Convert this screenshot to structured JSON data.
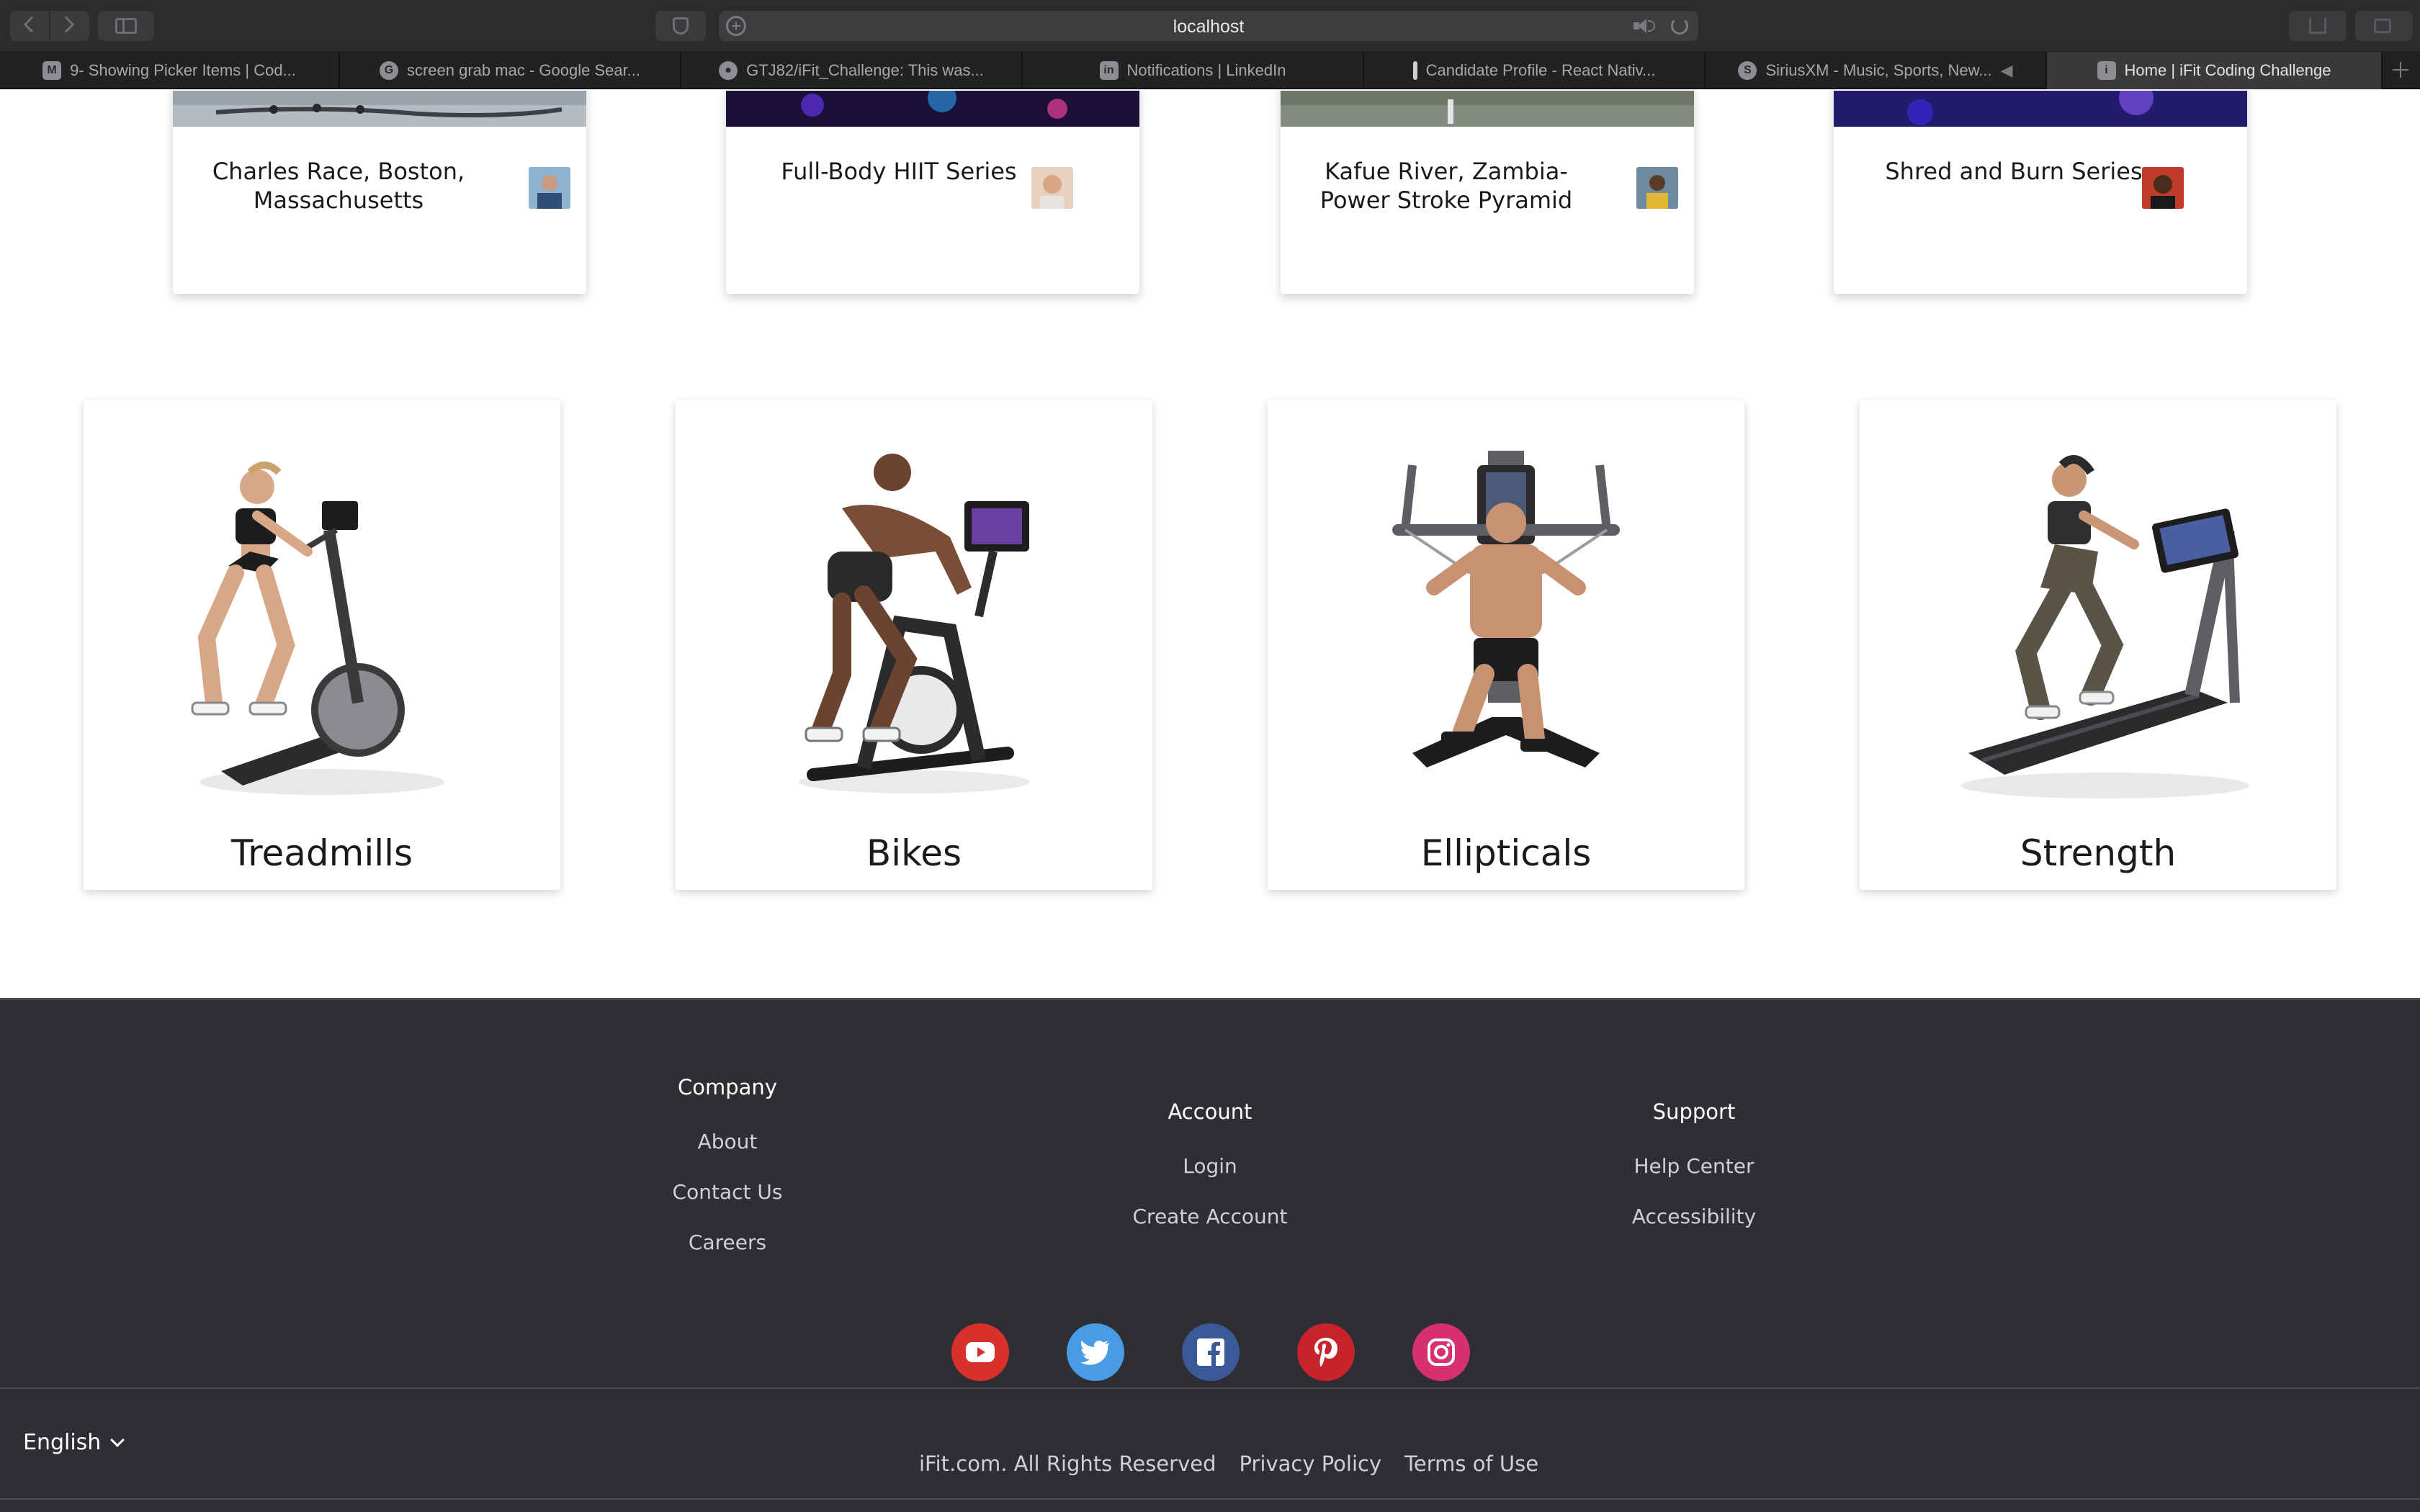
{
  "browser": {
    "address": "localhost",
    "tabs": [
      {
        "label": "9- Showing Picker Items | Cod...",
        "icon": "mosh-icon"
      },
      {
        "label": "screen grab mac - Google Sear...",
        "icon": "google-icon"
      },
      {
        "label": "GTJ82/iFit_Challenge: This was...",
        "icon": "github-icon"
      },
      {
        "label": "Notifications | LinkedIn",
        "icon": "linkedin-icon"
      },
      {
        "label": "Candidate Profile - React Nativ...",
        "icon": "pin-icon"
      },
      {
        "label": "SiriusXM - Music, Sports, New...",
        "icon": "siriusxm-icon"
      },
      {
        "label": "Home | iFit Coding Challenge",
        "icon": "ifit-icon"
      }
    ]
  },
  "workouts": [
    {
      "title": "Charles Race, Boston, Massachusetts"
    },
    {
      "title": "Full-Body HIIT Series"
    },
    {
      "title": "Kafue River, Zambia- Power Stroke Pyramid"
    },
    {
      "title": "Shred and Burn Series"
    }
  ],
  "equipment": [
    {
      "label": "Treadmills"
    },
    {
      "label": "Bikes"
    },
    {
      "label": "Ellipticals"
    },
    {
      "label": "Strength"
    }
  ],
  "footer": {
    "company": {
      "heading": "Company",
      "links": [
        "About",
        "Contact Us",
        "Careers"
      ]
    },
    "account": {
      "heading": "Account",
      "links": [
        "Login",
        "Create Account"
      ]
    },
    "support": {
      "heading": "Support",
      "links": [
        "Help Center",
        "Accessibility"
      ]
    },
    "social": [
      {
        "icon": "youtube-icon",
        "color": "#d9302b"
      },
      {
        "icon": "twitter-icon",
        "color": "#4a9be6"
      },
      {
        "icon": "facebook-icon",
        "color": "#3b5998"
      },
      {
        "icon": "pinterest-icon",
        "color": "#c8232c"
      },
      {
        "icon": "instagram-icon",
        "color": "#d6306f"
      }
    ],
    "language": "English",
    "copyright": "iFit.com. All Rights Reserved",
    "privacy": "Privacy Policy",
    "terms": "Terms of Use"
  }
}
